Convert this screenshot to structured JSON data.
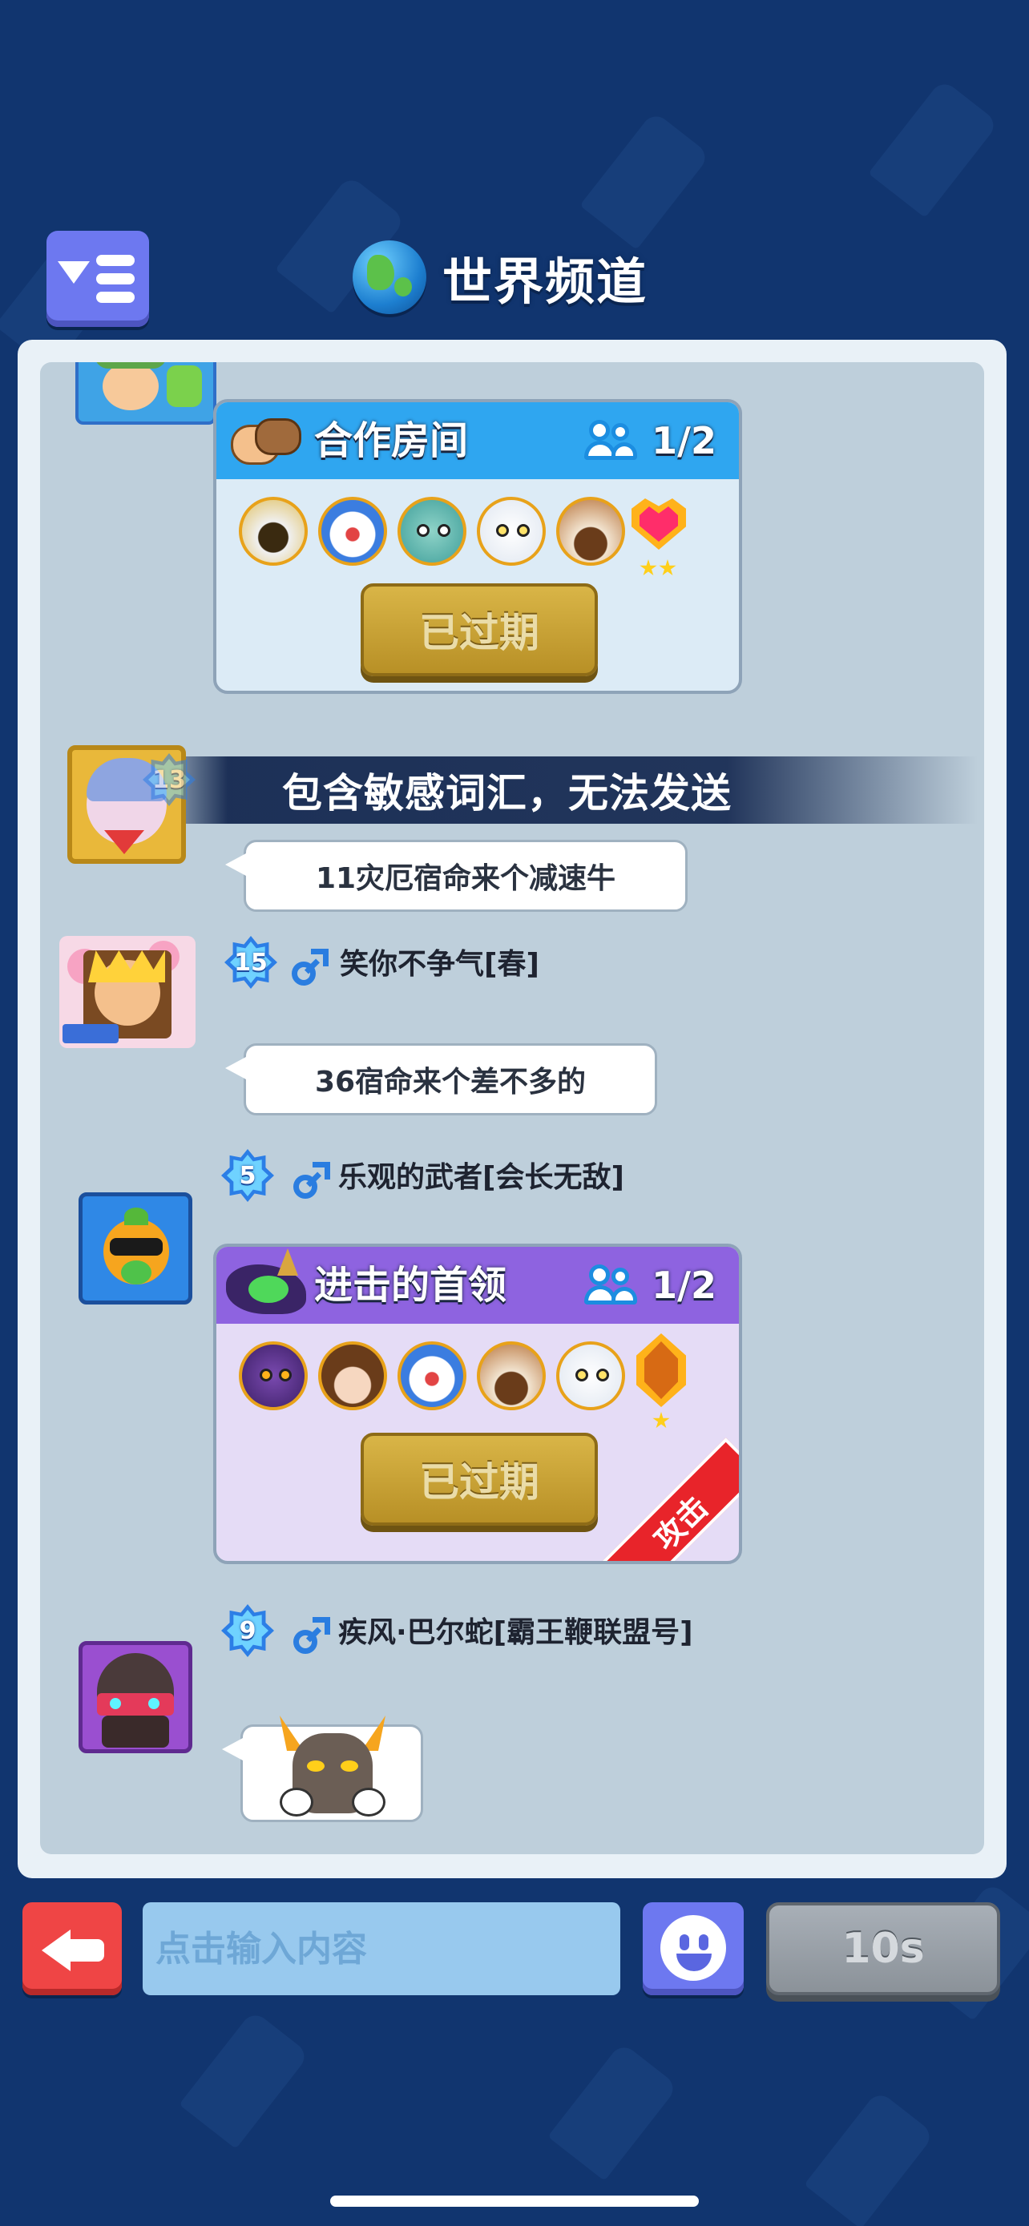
{
  "header": {
    "title": "世界频道",
    "menu_icon": "menu-list-icon",
    "globe_icon": "globe-icon"
  },
  "messages": [
    {
      "type": "room_card",
      "room_title": "合作房间",
      "players": "1/2",
      "button_label": "已过期",
      "theme_color": "#2fa6f0",
      "reward_gem": "heart-gem-icon",
      "reward_stars": 2
    },
    {
      "type": "text",
      "level": "13",
      "system_notice": "包含敏感词汇，无法发送",
      "text": "11灾厄宿命来个减速牛"
    },
    {
      "type": "text",
      "level": "15",
      "username": "笑你不争气[春]",
      "text": "36宿命来个差不多的"
    },
    {
      "type": "room_card",
      "level": "5",
      "username": "乐观的武者[会长无敌]",
      "room_title": "进击的首领",
      "players": "1/2",
      "button_label": "已过期",
      "corner_tag": "攻击",
      "theme_color": "#8e63e0",
      "reward_gem": "amber-gem-icon",
      "reward_stars": 1
    },
    {
      "type": "sticker",
      "level": "9",
      "username": "疾风·巴尔蛇[霸王鞭联盟号]",
      "sticker": "horned-monster-sticker"
    }
  ],
  "input": {
    "placeholder": "点击输入内容",
    "send_label": "10s"
  },
  "colors": {
    "background": "#11356f",
    "panel": "#becfdb",
    "button_blue": "#6d78f0",
    "button_red": "#ef4545"
  }
}
